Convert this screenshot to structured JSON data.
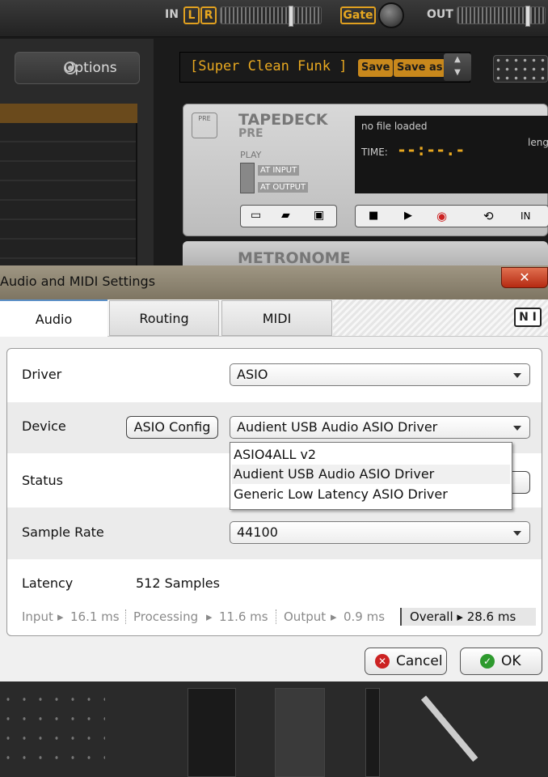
{
  "host": {
    "in_label": "IN",
    "l_label": "L",
    "r_label": "R",
    "gate_label": "Gate",
    "out_label": "OUT",
    "options_label": "Options",
    "preset_name": "[Super Clean Funk ]",
    "save_label": "Save",
    "save_as_label": "Save as",
    "tapedeck": {
      "pre_icon": "PRE",
      "title": "TAPEDECK",
      "subtitle": "PRE",
      "play_label": "PLAY",
      "at_input": "AT INPUT",
      "at_output": "AT OUTPUT",
      "file_status": "no file loaded",
      "time_label": "TIME:",
      "time_value": "--:--.-",
      "length_label": "leng",
      "in_button": "IN"
    },
    "metronome_title": "METRONOME"
  },
  "dialog": {
    "title": "Audio and MIDI Settings",
    "close_glyph": "✕",
    "tabs": [
      {
        "label": "Audio",
        "active": true
      },
      {
        "label": "Routing",
        "active": false
      },
      {
        "label": "MIDI",
        "active": false
      }
    ],
    "logo_text": "N I",
    "driver": {
      "label": "Driver",
      "value": "ASIO"
    },
    "device": {
      "label": "Device",
      "config_button": "ASIO Config",
      "value": "Audient USB Audio ASIO Driver",
      "options": [
        "ASIO4ALL v2",
        "Audient USB Audio ASIO Driver",
        "Generic Low Latency ASIO Driver"
      ],
      "highlighted_option": 1
    },
    "status": {
      "label": "Status"
    },
    "sample_rate": {
      "label": "Sample Rate",
      "value": "44100"
    },
    "latency": {
      "label": "Latency",
      "value": "512 Samples",
      "input_label": "Input",
      "input_value": "16.1 ms",
      "processing_label": "Processing",
      "processing_value": "11.6 ms",
      "output_label": "Output",
      "output_value": "0.9 ms",
      "overall_label": "Overall",
      "overall_value": "28.6 ms"
    },
    "cancel_label": "Cancel",
    "ok_label": "OK"
  },
  "colors": {
    "accent_orange": "#e8a820",
    "tab_active_border": "#5b8fc7",
    "cancel_icon": "#cc2222",
    "ok_icon": "#2e9a2e",
    "close_button": "#c63a1e"
  },
  "icons": [
    "options-radio-icon",
    "new-file-icon",
    "open-folder-icon",
    "save-disk-icon",
    "stop-icon",
    "play-icon",
    "record-icon",
    "loop-icon",
    "dropdown-arrow-icon",
    "cancel-icon",
    "ok-check-icon",
    "close-icon",
    "ni-logo-icon"
  ]
}
